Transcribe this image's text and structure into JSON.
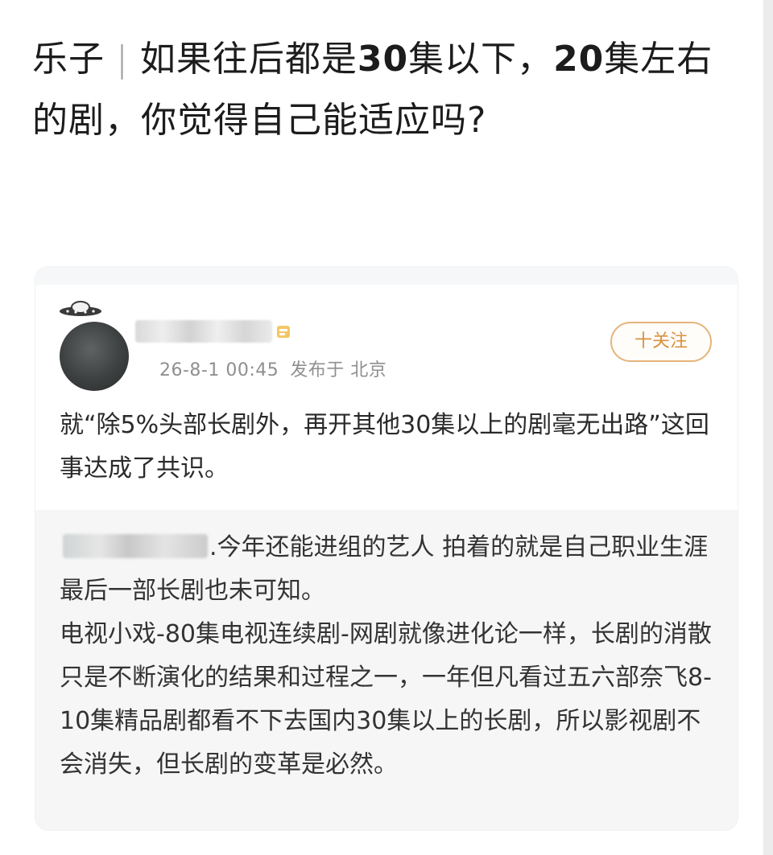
{
  "title": {
    "prefix": "乐子",
    "separator": "|",
    "part1": "如果往后都是",
    "num1": "30",
    "part2": "集以下，",
    "num2": "20",
    "part3": "集左右的剧，你觉得自己能适应吗?"
  },
  "post": {
    "timestamp": "26-8-1 00:45",
    "location": "发布于 北京",
    "follow_label": "十关注",
    "body": "就“除5%头部长剧外，再开其他30集以上的剧毫无出路”这回事达成了共识。"
  },
  "quote": {
    "lines": [
      ".今年还能进组的艺人 拍着的就是自己职业生涯最后一部长剧也未可知。",
      "电视小戏-80集电视连续剧-网剧就像进化论一样，长剧的消散只是不断演化的结果和过程之一，一年但凡看过五六部奈飞8-10集精品剧都看不下去国内30集以上的长剧，所以影视剧不会消失，但长剧的变革是必然。"
    ]
  },
  "colors": {
    "follow_accent": "#d9913e",
    "meta_text": "#8f8f8f",
    "quote_background": "#f6f6f6"
  },
  "icons": {
    "avatar_pendant": "ufo-icon",
    "verified_badge": "badge-icon"
  }
}
